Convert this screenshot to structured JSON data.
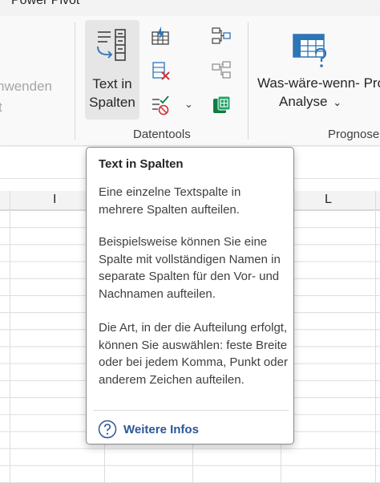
{
  "ribbon": {
    "tab_power_pivot": "Power Pivot",
    "prev_group_label": "nwenden",
    "prev_group_label2": "t",
    "text_in_columns": {
      "line1": "Text in",
      "line2": "Spalten",
      "icon": "text-to-columns-icon"
    },
    "small_buttons": [
      {
        "icon": "flash-fill-icon"
      },
      {
        "icon": "remove-duplicates-icon"
      },
      {
        "icon": "data-validation-icon"
      },
      {
        "icon": "consolidate-icon"
      },
      {
        "icon": "relationships-icon"
      },
      {
        "icon": "data-model-icon"
      }
    ],
    "datentools_label": "Datentools",
    "what_if": {
      "line1": "Was-wäre-wenn- Pro",
      "line2": "Analyse",
      "chevron": "⌄"
    },
    "prognose_label": "Prognose"
  },
  "sheet": {
    "columns": [
      "I",
      "L"
    ]
  },
  "tooltip": {
    "title": "Text in Spalten",
    "para1": "Eine einzelne Textspalte in mehrere Spalten aufteilen.",
    "para2": "Beispielsweise können Sie eine Spalte mit vollständigen Namen in separate Spalten für den Vor- und Nachnamen aufteilen.",
    "para3": "Die Art, in der die Aufteilung erfolgt, können Sie auswählen: feste Breite oder bei jedem Komma, Punkt oder anderem Zeichen aufteilen.",
    "link": "Weitere Infos",
    "link_color": "#2b5797"
  }
}
